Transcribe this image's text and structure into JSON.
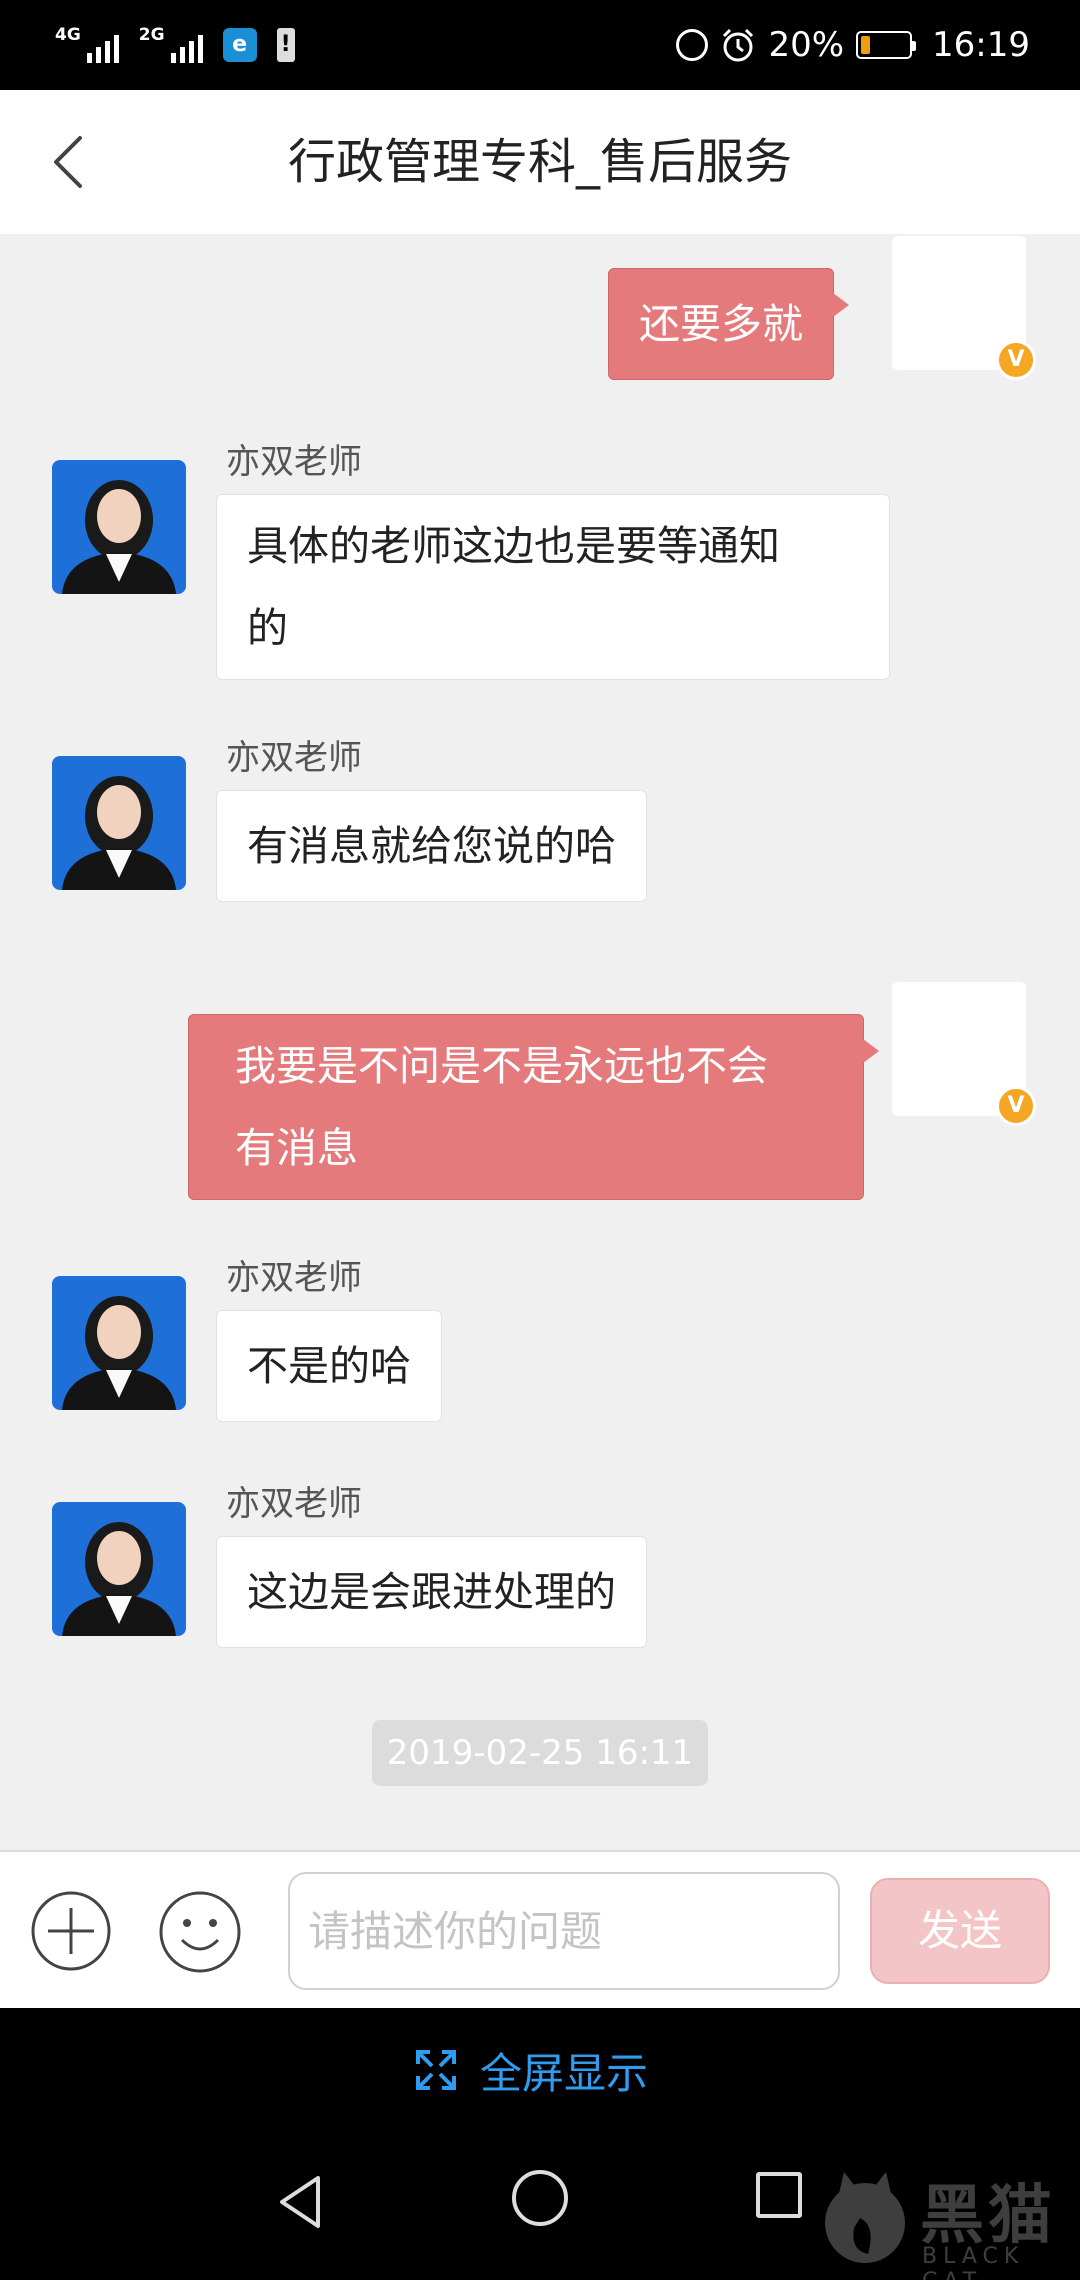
{
  "status_bar": {
    "network_1": "4G",
    "network_2": "2G",
    "battery_percent": "20%",
    "battery_level": 0.2,
    "time": "16:19",
    "app_badge": "e",
    "warning_badge": "!"
  },
  "header": {
    "title": "行政管理专科_售后服务"
  },
  "messages": [
    {
      "side": "out",
      "text": "还要多就",
      "badge": "V"
    },
    {
      "side": "in",
      "sender": "亦双老师",
      "text_line1": "具体的老师这边也是要等通知",
      "text_line2": "的"
    },
    {
      "side": "in",
      "sender": "亦双老师",
      "text": "有消息就给您说的哈"
    },
    {
      "side": "out",
      "text_line1": "我要是不问是不是永远也不会",
      "text_line2": "有消息",
      "badge": "V"
    },
    {
      "side": "in",
      "sender": "亦双老师",
      "text": "不是的哈"
    },
    {
      "side": "in",
      "sender": "亦双老师",
      "text": "这边是会跟进处理的"
    }
  ],
  "timestamp": "2019-02-25 16:11",
  "input_bar": {
    "placeholder": "请描述你的问题",
    "value": "",
    "send_label": "发送"
  },
  "fullscreen": {
    "label": "全屏显示"
  },
  "watermark": {
    "big": "黑猫",
    "small": "BLACK CAT"
  },
  "colors": {
    "outgoing_bubble": "#e57a7c",
    "chat_background": "#f0f0f0",
    "send_button": "#f4c5c6",
    "link_blue": "#2e9cf0",
    "badge_orange": "#f5a623"
  },
  "icons": [
    "back-chevron-icon",
    "plus-circle-icon",
    "emoji-face-icon",
    "fullscreen-expand-icon",
    "nav-back-icon",
    "nav-home-icon",
    "nav-recent-icon",
    "alarm-icon",
    "data-saver-icon"
  ]
}
